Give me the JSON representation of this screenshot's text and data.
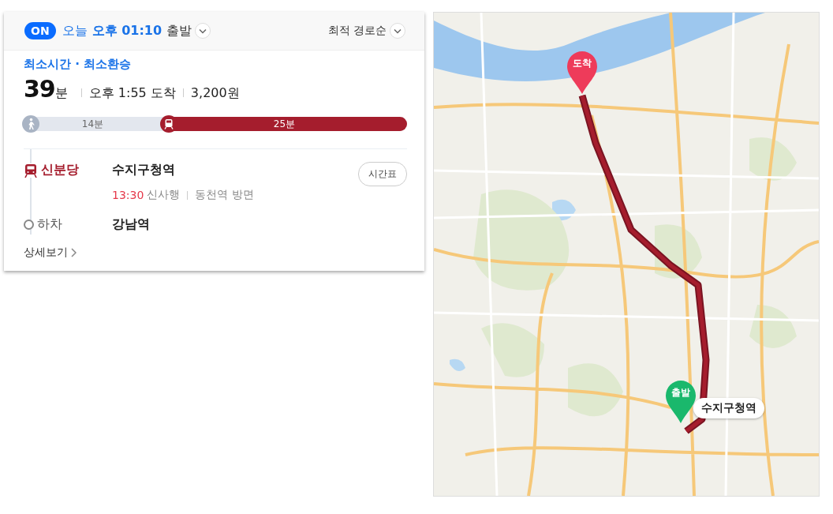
{
  "header": {
    "realtime_badge": "ON",
    "realtime_on": true,
    "day": "오늘",
    "time": "오후 01:10",
    "suffix": "출발",
    "sort": "최적 경로순"
  },
  "route": {
    "tags": "최소시간 · 최소환승",
    "duration": "39",
    "duration_unit": "분",
    "arrival": "오후 1:55 도착",
    "fare": "3,200원",
    "segments": [
      {
        "kind": "walk",
        "label": "14분",
        "level": 0.36
      },
      {
        "kind": "subway",
        "label": "25분",
        "level": 0.64
      }
    ],
    "steps": [
      {
        "kind": "board",
        "line": "신분당",
        "station": "수지구청역",
        "timetable": "시간표",
        "departure": "13:30",
        "direction": "신사행",
        "platform": "동천역 방면"
      },
      {
        "kind": "alight",
        "line": "하차",
        "station": "강남역"
      }
    ],
    "details_link": "상세보기"
  },
  "map": {
    "markers": [
      {
        "kind": "arrival",
        "label": "도착"
      },
      {
        "kind": "departure",
        "label": "출발",
        "callout": "수지구청역"
      }
    ]
  }
}
